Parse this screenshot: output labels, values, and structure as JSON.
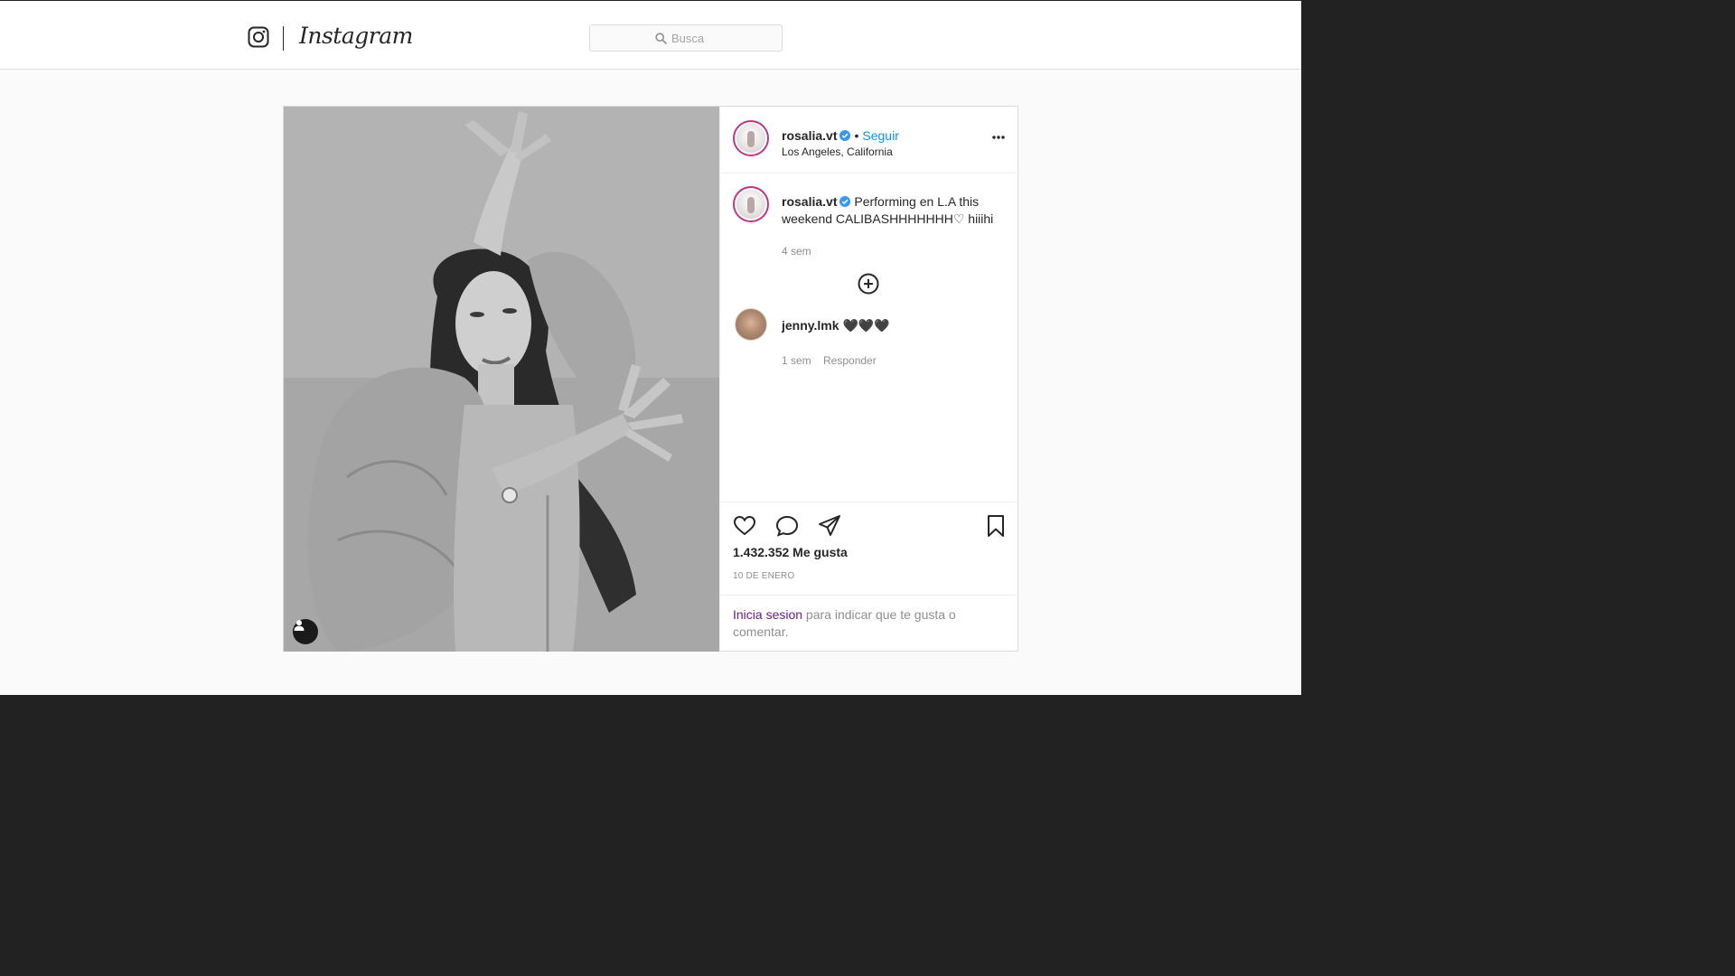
{
  "colors": {
    "accent_link": "#0095f6",
    "login_link": "#6a1b9a",
    "avatar_ring": "#c13584",
    "verified_badge": "#3897f0",
    "outside_background": "#222222"
  },
  "header": {
    "brand": "Instagram",
    "logo_icon": "instagram-camera-icon",
    "search": {
      "placeholder": "Busca",
      "icon": "search-icon"
    }
  },
  "post": {
    "author": {
      "username": "rosalia.vt",
      "verified": true,
      "follow_label": "Seguir",
      "separator": "•",
      "location": "Los Angeles, California"
    },
    "more_icon": "more-options-icon",
    "caption": {
      "username": "rosalia.vt",
      "text": "Performing en L.A this weekend CALIBASHHHHHHH♡ hiiihi",
      "time": "4 sem"
    },
    "load_more_icon": "plus-circle-icon",
    "comments": [
      {
        "username": "jenny.lmk",
        "text": "🖤🖤🖤",
        "time": "1 sem",
        "reply_label": "Responder"
      }
    ],
    "actions": {
      "like_icon": "heart-icon",
      "comment_icon": "comment-icon",
      "share_icon": "share-icon",
      "save_icon": "bookmark-icon"
    },
    "likes": "1.432.352 Me gusta",
    "date": "10 DE ENERO",
    "login_prompt": {
      "link": "Inicia sesion",
      "rest": " para indicar que te gusta o comentar."
    },
    "user_tag_icon": "user-tag-icon"
  }
}
